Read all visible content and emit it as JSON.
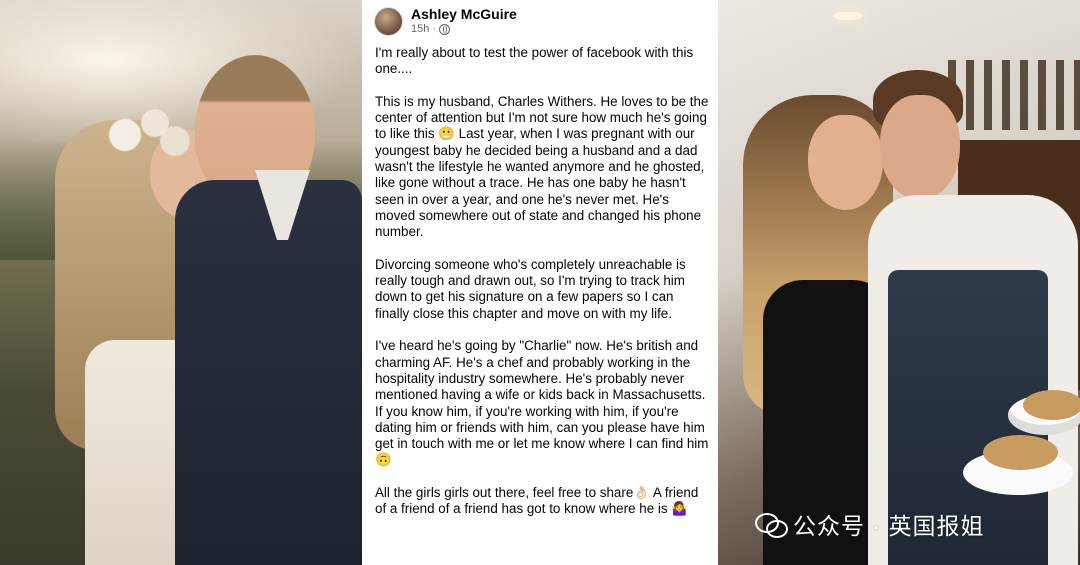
{
  "post": {
    "author": "Ashley McGuire",
    "time": "15h",
    "paragraphs": [
      "I'm really about to test the power of facebook with this one....",
      "This is my husband, Charles Withers. He loves to be the center of attention but I'm not sure how much he's going to like this 😬 Last year, when I was pregnant with our\nyoungest baby he decided being a husband and a dad wasn't the lifestyle he wanted anymore and he ghosted, like gone without a trace. He has one baby he hasn't seen in over a year, and one he's never met. He's moved somewhere out of state and changed his phone number.",
      "Divorcing someone who's completely unreachable is really tough and drawn out, so I'm trying to track him down to get his signature on a few papers so I can finally close this chapter and move on with my life.",
      "I've heard he's going by \"Charlie\" now. He's british and charming AF. He's a chef and probably working in the hospitality industry somewhere. He's probably never mentioned having a wife or kids back in Massachusetts. If you know him, if you're working with him, if you're dating him or friends with him, can you please have him get in touch with me or let me know where I can find him 🙃",
      "All the girls girls out there, feel free to share👌🏻 A friend of a friend of a friend has got to know where he is 🤷‍♀️"
    ]
  },
  "watermark": {
    "text": "公众号 · 英国报姐",
    "icon": "wechat-icon"
  },
  "photos": {
    "left": "wedding-couple-photo",
    "right": "restaurant-couple-photo"
  }
}
